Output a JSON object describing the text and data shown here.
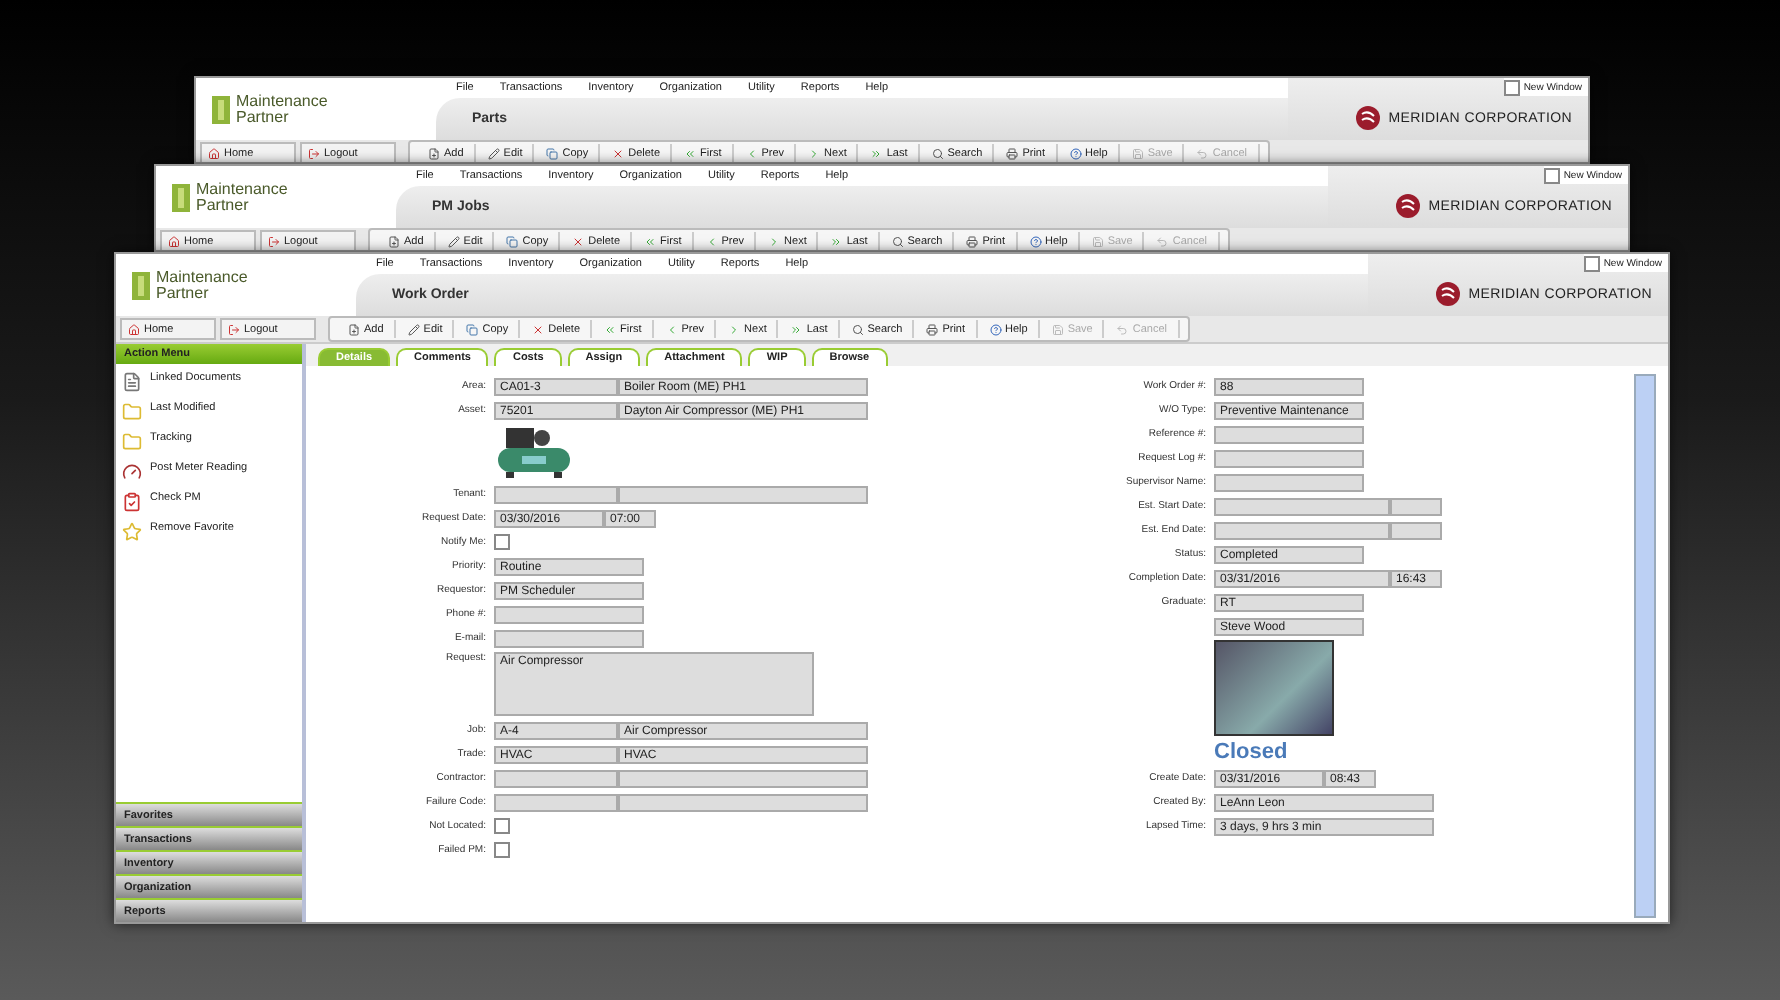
{
  "windows": [
    {
      "title": "Parts",
      "logo": "Maintenance Partner",
      "company": "MERIDIAN CORPORATION",
      "new_window": {
        "label": "New Window",
        "checked": false
      },
      "menu": [
        "File",
        "Transactions",
        "Inventory",
        "Organization",
        "Utility",
        "Reports",
        "Help"
      ],
      "nav": [
        "Home",
        "Logout"
      ],
      "toolbar": [
        {
          "label": "Add",
          "disabled": false
        },
        {
          "label": "Edit",
          "disabled": false
        },
        {
          "label": "Copy",
          "disabled": false
        },
        {
          "label": "Delete",
          "disabled": false
        },
        {
          "label": "First",
          "disabled": false
        },
        {
          "label": "Prev",
          "disabled": false
        },
        {
          "label": "Next",
          "disabled": false
        },
        {
          "label": "Last",
          "disabled": false
        },
        {
          "label": "Search",
          "disabled": false
        },
        {
          "label": "Print",
          "disabled": false
        },
        {
          "label": "Help",
          "disabled": false
        },
        {
          "label": "Save",
          "disabled": true
        },
        {
          "label": "Cancel",
          "disabled": true
        }
      ]
    },
    {
      "title": "PM Jobs",
      "logo": "Maintenance Partner",
      "company": "MERIDIAN CORPORATION",
      "new_window": {
        "label": "New Window",
        "checked": false
      },
      "menu": [
        "File",
        "Transactions",
        "Inventory",
        "Organization",
        "Utility",
        "Reports",
        "Help"
      ],
      "nav": [
        "Home",
        "Logout"
      ],
      "toolbar": [
        {
          "label": "Add",
          "disabled": false
        },
        {
          "label": "Edit",
          "disabled": false
        },
        {
          "label": "Copy",
          "disabled": false
        },
        {
          "label": "Delete",
          "disabled": false
        },
        {
          "label": "First",
          "disabled": false
        },
        {
          "label": "Prev",
          "disabled": false
        },
        {
          "label": "Next",
          "disabled": false
        },
        {
          "label": "Last",
          "disabled": false
        },
        {
          "label": "Search",
          "disabled": false
        },
        {
          "label": "Print",
          "disabled": false
        },
        {
          "label": "Help",
          "disabled": false
        },
        {
          "label": "Save",
          "disabled": true
        },
        {
          "label": "Cancel",
          "disabled": true
        }
      ]
    },
    {
      "title": "Work Order",
      "logo": "Maintenance Partner",
      "company": "MERIDIAN CORPORATION",
      "new_window": {
        "label": "New Window",
        "checked": false
      },
      "menu": [
        "File",
        "Transactions",
        "Inventory",
        "Organization",
        "Utility",
        "Reports",
        "Help"
      ],
      "nav": [
        "Home",
        "Logout"
      ],
      "toolbar": [
        {
          "label": "Add",
          "disabled": false
        },
        {
          "label": "Edit",
          "disabled": false
        },
        {
          "label": "Copy",
          "disabled": false
        },
        {
          "label": "Delete",
          "disabled": false
        },
        {
          "label": "First",
          "disabled": false
        },
        {
          "label": "Prev",
          "disabled": false
        },
        {
          "label": "Next",
          "disabled": false
        },
        {
          "label": "Last",
          "disabled": false
        },
        {
          "label": "Search",
          "disabled": false
        },
        {
          "label": "Print",
          "disabled": false
        },
        {
          "label": "Help",
          "disabled": false
        },
        {
          "label": "Save",
          "disabled": true
        },
        {
          "label": "Cancel",
          "disabled": true
        }
      ]
    }
  ],
  "sidebar": {
    "header": "Action Menu",
    "items": [
      "Linked Documents",
      "Last Modified",
      "Tracking",
      "Post Meter Reading",
      "Check PM",
      "Remove Favorite"
    ],
    "sections": [
      "Favorites",
      "Transactions",
      "Inventory",
      "Organization",
      "Reports"
    ]
  },
  "tabs": [
    {
      "label": "Details",
      "selected": true
    },
    {
      "label": "Comments",
      "selected": false
    },
    {
      "label": "Costs",
      "selected": false
    },
    {
      "label": "Assign",
      "selected": false
    },
    {
      "label": "Attachment",
      "selected": false
    },
    {
      "label": "WIP",
      "selected": false
    },
    {
      "label": "Browse",
      "selected": false
    }
  ],
  "left_fields": [
    {
      "kind": "wide_pair",
      "label": "Area:",
      "value": "CA01-3",
      "value_2": "Boiler Room (ME) PH1"
    },
    {
      "kind": "wide_pair",
      "label": "Asset:",
      "value": "75201",
      "value_2": "Dayton Air Compressor (ME) PH1"
    },
    {
      "kind": "picture"
    },
    {
      "kind": "wide_pair",
      "label": "Tenant:"
    },
    {
      "kind": "datetime",
      "label": "Request Date:",
      "value": "03/30/2016",
      "value_2": "07:00"
    },
    {
      "kind": "check",
      "label": "Notify Me:",
      "checked": false
    },
    {
      "kind": "text",
      "label": "Priority:",
      "value": "Routine"
    },
    {
      "kind": "text",
      "label": "Requestor:",
      "value": "PM Scheduler"
    },
    {
      "kind": "text",
      "label": "Phone #:"
    },
    {
      "kind": "text",
      "label": "E-mail:"
    },
    {
      "kind": "memo",
      "label": "Request:",
      "value": "Air Compressor"
    },
    {
      "kind": "wide_pair",
      "label": "Job:",
      "value": "A-4",
      "value_2": "Air Compressor"
    },
    {
      "kind": "wide_pair",
      "label": "Trade:",
      "value": "HVAC",
      "value_2": "HVAC"
    },
    {
      "kind": "wide_pair",
      "label": "Contractor:"
    },
    {
      "kind": "wide_pair",
      "label": "Failure Code:"
    },
    {
      "kind": "check",
      "label": "Not Located:",
      "checked": false
    },
    {
      "kind": "check",
      "label": "Failed PM:",
      "checked": false
    }
  ],
  "right_fields": [
    {
      "kind": "text",
      "label": "Work Order #:",
      "value": "88"
    },
    {
      "kind": "text",
      "label": "W/O Type:",
      "value": "Preventive Maintenance"
    },
    {
      "kind": "text",
      "label": "Reference #:"
    },
    {
      "kind": "text",
      "label": "Request Log #:"
    },
    {
      "kind": "text",
      "label": "Supervisor Name:"
    },
    {
      "kind": "split",
      "label": "Est. Start Date:"
    },
    {
      "kind": "split",
      "label": "Est. End Date:"
    },
    {
      "kind": "text",
      "label": "Status:",
      "value": "Completed"
    },
    {
      "kind": "split",
      "label": "Completion Date:",
      "value": "03/31/2016",
      "value_2": "16:43"
    },
    {
      "kind": "text",
      "label": "Graduate:",
      "value": "RT"
    },
    {
      "kind": "text",
      "value": "Steve Wood"
    },
    {
      "kind": "photo"
    },
    {
      "kind": "status",
      "value": "Closed"
    },
    {
      "kind": "datetime",
      "label": "Create Date:",
      "value": "03/31/2016",
      "value_2": "08:43"
    },
    {
      "kind": "long",
      "label": "Created By:",
      "value": "LeAnn Leon"
    },
    {
      "kind": "long",
      "label": "Lapsed Time:",
      "value": "3 days, 9 hrs 3 min"
    }
  ]
}
